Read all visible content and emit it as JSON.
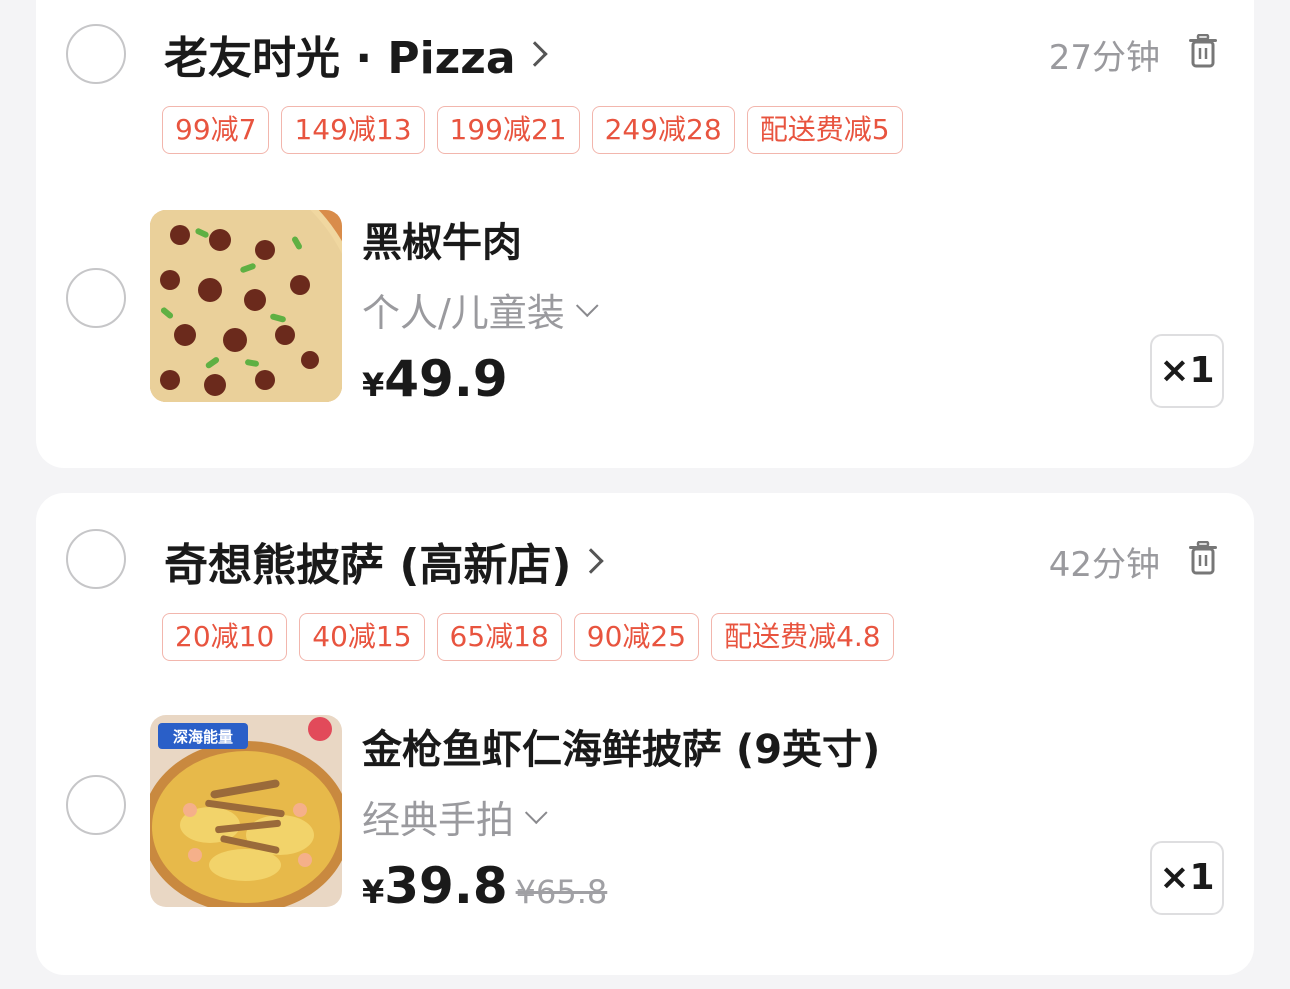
{
  "stores": [
    {
      "name": "老友时光 · Pizza",
      "eta": "27分钟",
      "promos": [
        "99减7",
        "149减13",
        "199减21",
        "249减28",
        "配送费减5"
      ],
      "item": {
        "title": "黑椒牛肉",
        "spec": "个人/儿童装",
        "currency": "¥",
        "price": "49.9",
        "original_price": "",
        "quantity": "×1"
      }
    },
    {
      "name": "奇想熊披萨 (高新店)",
      "eta": "42分钟",
      "promos": [
        "20减10",
        "40减15",
        "65减18",
        "90减25",
        "配送费减4.8"
      ],
      "item": {
        "title": "金枪鱼虾仁海鲜披萨 (9英寸)",
        "spec": "经典手拍",
        "currency": "¥",
        "price": "39.8",
        "original_price": "¥65.8",
        "quantity": "×1",
        "image_badge": "深海能量"
      }
    }
  ],
  "icons": {
    "radio": "radio-unchecked-icon",
    "trash": "trash-icon",
    "chevron_right": "chevron-right-icon",
    "chevron_down": "chevron-down-icon"
  },
  "colors": {
    "promo_text": "#e8543f",
    "promo_border": "#f2b6ad",
    "muted_text": "#9a9a9e",
    "card_bg": "#ffffff",
    "page_bg": "#f4f4f6"
  }
}
